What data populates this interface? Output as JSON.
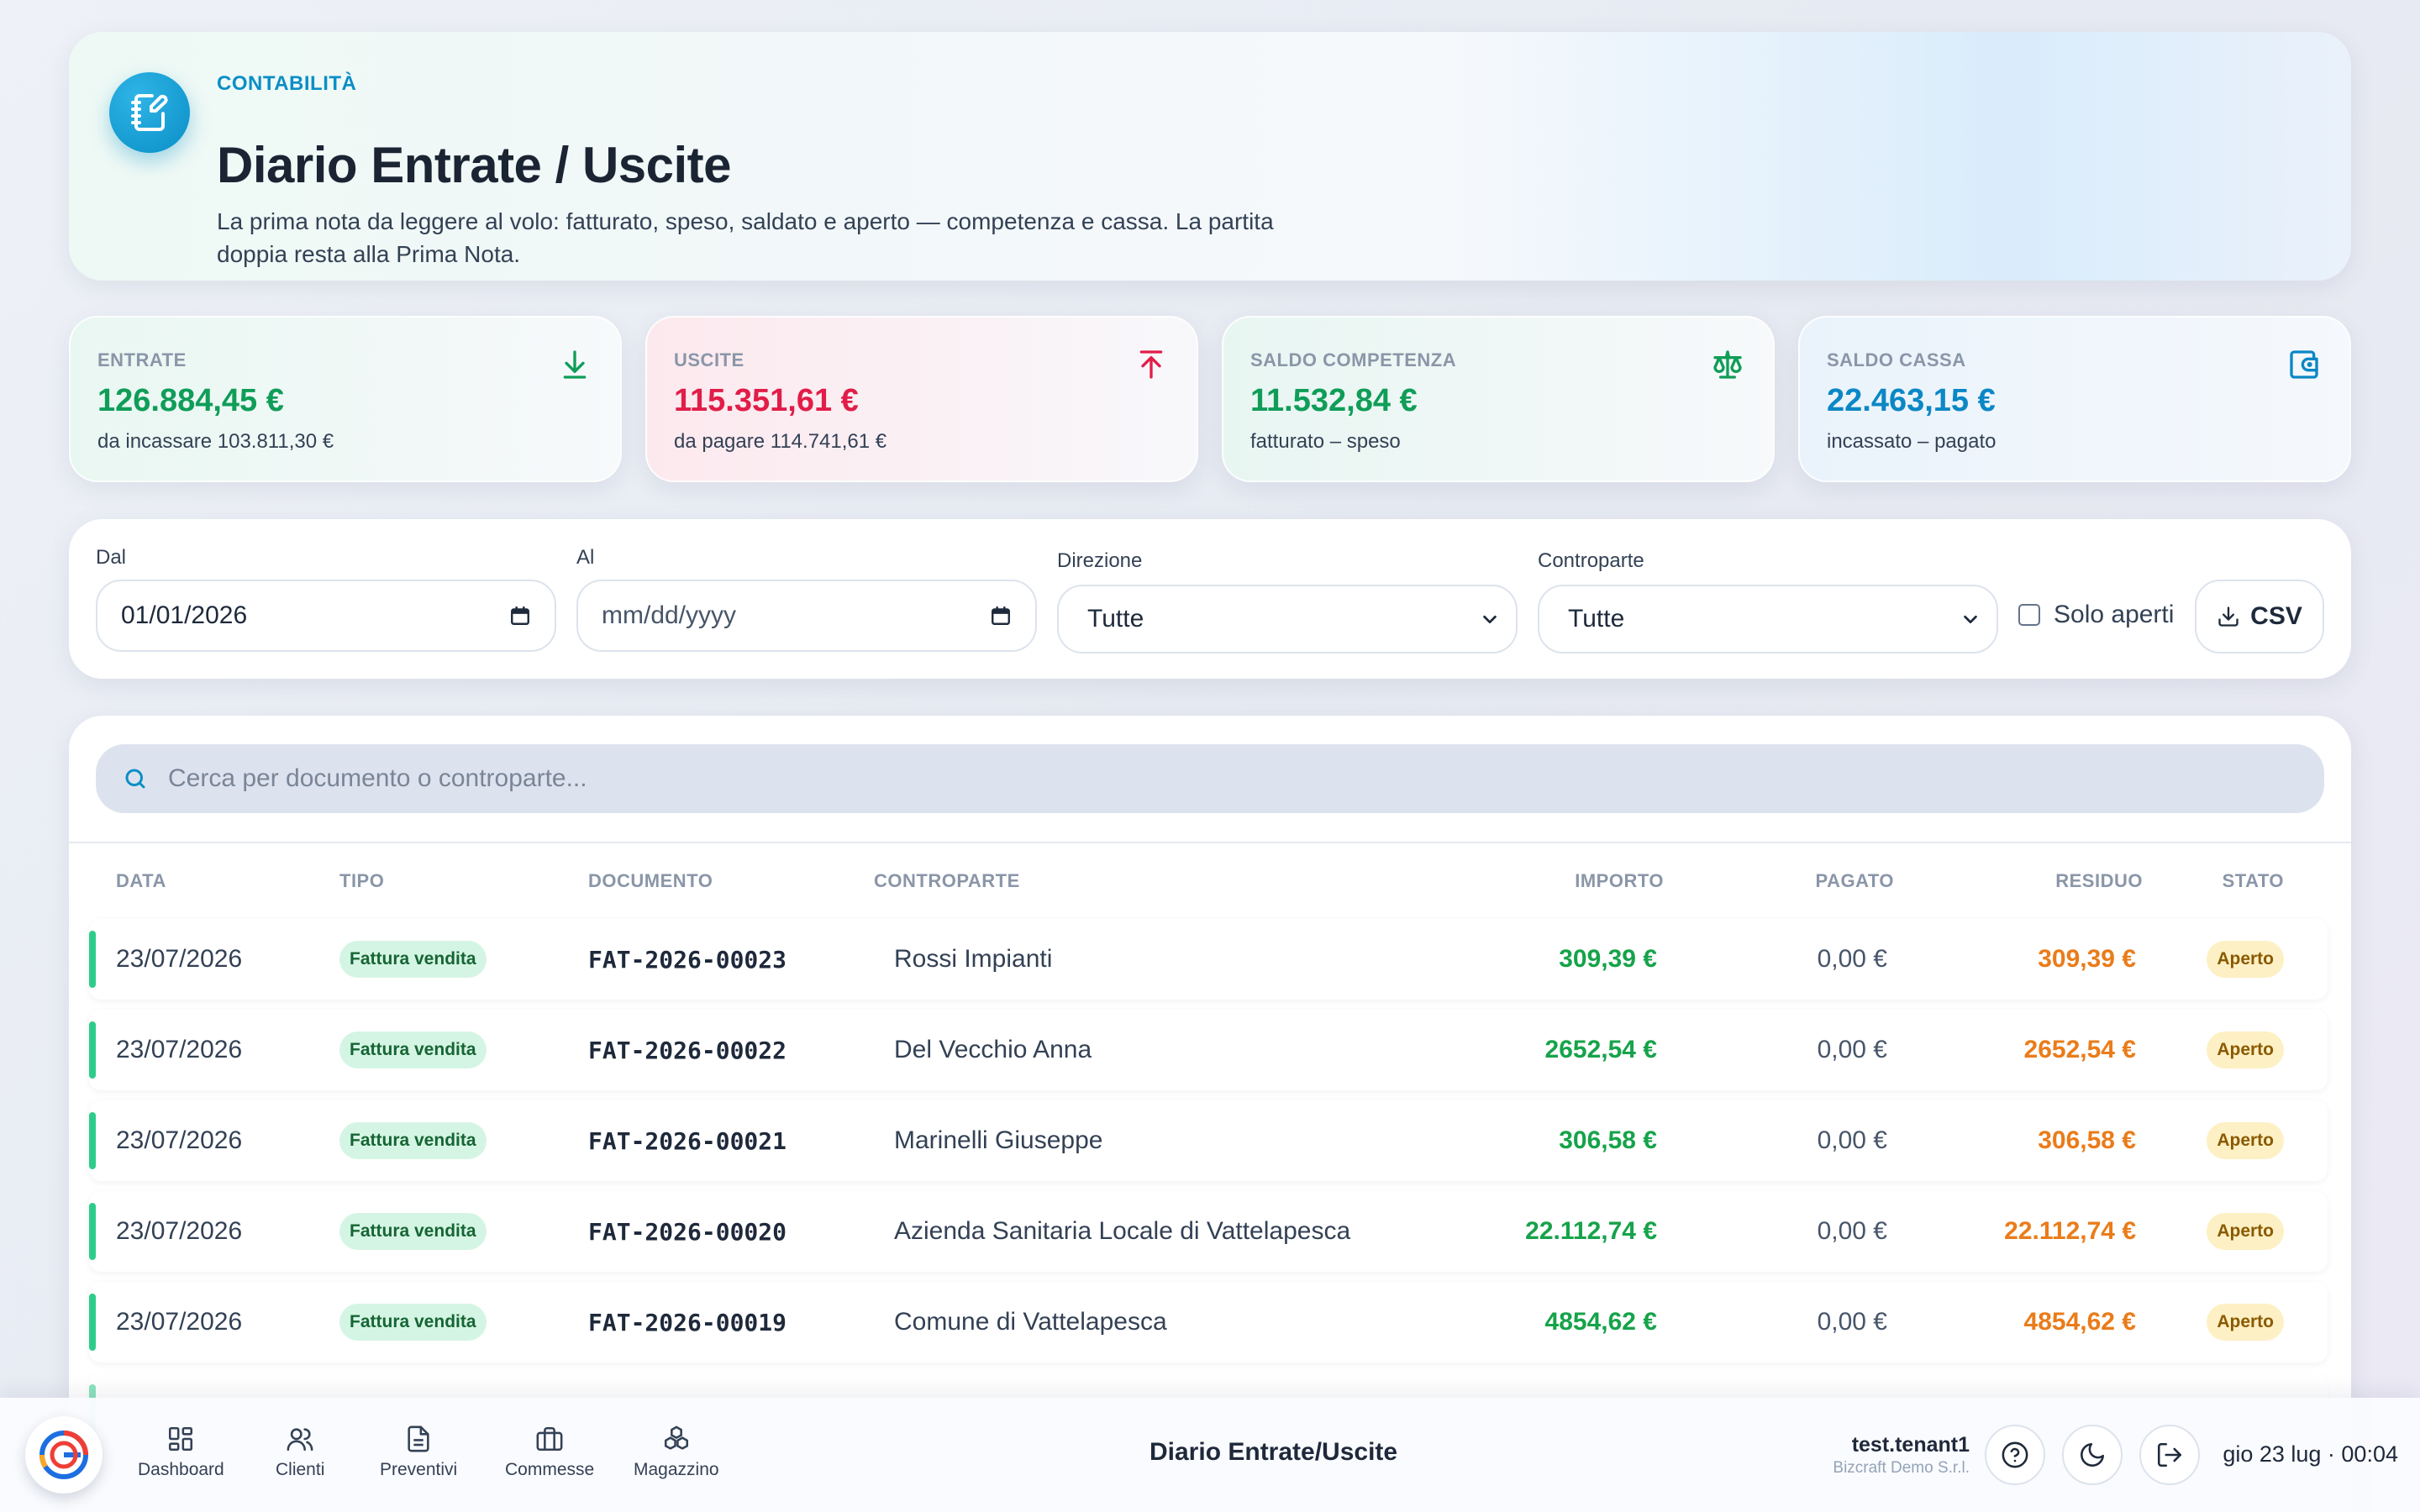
{
  "header": {
    "eyebrow": "CONTABILITÀ",
    "title": "Diario Entrate / Uscite",
    "description": "La prima nota da leggere al volo: fatturato, speso, saldato e aperto — competenza e cassa. La partita doppia resta alla Prima Nota.",
    "icon": "notebook-edit-icon"
  },
  "kpis": [
    {
      "label": "ENTRATE",
      "value": "126.884,45 €",
      "sub": "da incassare 103.811,30 €",
      "color": "#0f9d58",
      "icon": "download-icon"
    },
    {
      "label": "USCITE",
      "value": "115.351,61 €",
      "sub": "da pagare 114.741,61 €",
      "color": "#e11d48",
      "icon": "upload-icon"
    },
    {
      "label": "SALDO COMPETENZA",
      "value": "11.532,84 €",
      "sub": "fatturato – speso",
      "color": "#0f9d58",
      "icon": "scale-icon"
    },
    {
      "label": "SALDO CASSA",
      "value": "22.463,15 €",
      "sub": "incassato – pagato",
      "color": "#0b87c5",
      "icon": "wallet-icon"
    }
  ],
  "filters": {
    "dal_label": "Dal",
    "dal_value": "01/01/2026",
    "al_label": "Al",
    "al_value": "mm/dd/yyyy",
    "direzione_label": "Direzione",
    "direzione_value": "Tutte",
    "controparte_label": "Controparte",
    "controparte_value": "Tutte",
    "solo_aperti_label": "Solo aperti",
    "solo_aperti_checked": false,
    "csv_label": "CSV"
  },
  "search": {
    "placeholder": "Cerca per documento o controparte..."
  },
  "table": {
    "headers": {
      "data": "DATA",
      "tipo": "TIPO",
      "documento": "DOCUMENTO",
      "controparte": "CONTROPARTE",
      "importo": "IMPORTO",
      "pagato": "PAGATO",
      "residuo": "RESIDUO",
      "stato": "STATO"
    },
    "rows": [
      {
        "data": "23/07/2026",
        "tipo": "Fattura vendita",
        "documento": "FAT-2026-00023",
        "controparte": "Rossi Impianti",
        "importo": "309,39 €",
        "pagato": "0,00 €",
        "residuo": "309,39 €",
        "stato": "Aperto"
      },
      {
        "data": "23/07/2026",
        "tipo": "Fattura vendita",
        "documento": "FAT-2026-00022",
        "controparte": "Del Vecchio Anna",
        "importo": "2652,54 €",
        "pagato": "0,00 €",
        "residuo": "2652,54 €",
        "stato": "Aperto"
      },
      {
        "data": "23/07/2026",
        "tipo": "Fattura vendita",
        "documento": "FAT-2026-00021",
        "controparte": "Marinelli Giuseppe",
        "importo": "306,58 €",
        "pagato": "0,00 €",
        "residuo": "306,58 €",
        "stato": "Aperto"
      },
      {
        "data": "23/07/2026",
        "tipo": "Fattura vendita",
        "documento": "FAT-2026-00020",
        "controparte": "Azienda Sanitaria Locale di Vattelapesca",
        "importo": "22.112,74 €",
        "pagato": "0,00 €",
        "residuo": "22.112,74 €",
        "stato": "Aperto"
      },
      {
        "data": "23/07/2026",
        "tipo": "Fattura vendita",
        "documento": "FAT-2026-00019",
        "controparte": "Comune di Vattelapesca",
        "importo": "4854,62 €",
        "pagato": "0,00 €",
        "residuo": "4854,62 €",
        "stato": "Aperto"
      }
    ]
  },
  "bottom_bar": {
    "nav": [
      {
        "label": "Dashboard",
        "icon": "grid-icon"
      },
      {
        "label": "Clienti",
        "icon": "users-icon"
      },
      {
        "label": "Preventivi",
        "icon": "document-icon"
      },
      {
        "label": "Commesse",
        "icon": "briefcase-icon"
      },
      {
        "label": "Magazzino",
        "icon": "boxes-icon"
      }
    ],
    "title": "Diario Entrate/Uscite",
    "user_name": "test.tenant1",
    "user_company": "Bizcraft Demo S.r.l.",
    "clock": "gio 23 lug · 00:04"
  },
  "colors": {
    "accent": "#0b8ec6",
    "positive": "#16a34a",
    "negative": "#e11d48",
    "warning": "#ea7c1a"
  }
}
